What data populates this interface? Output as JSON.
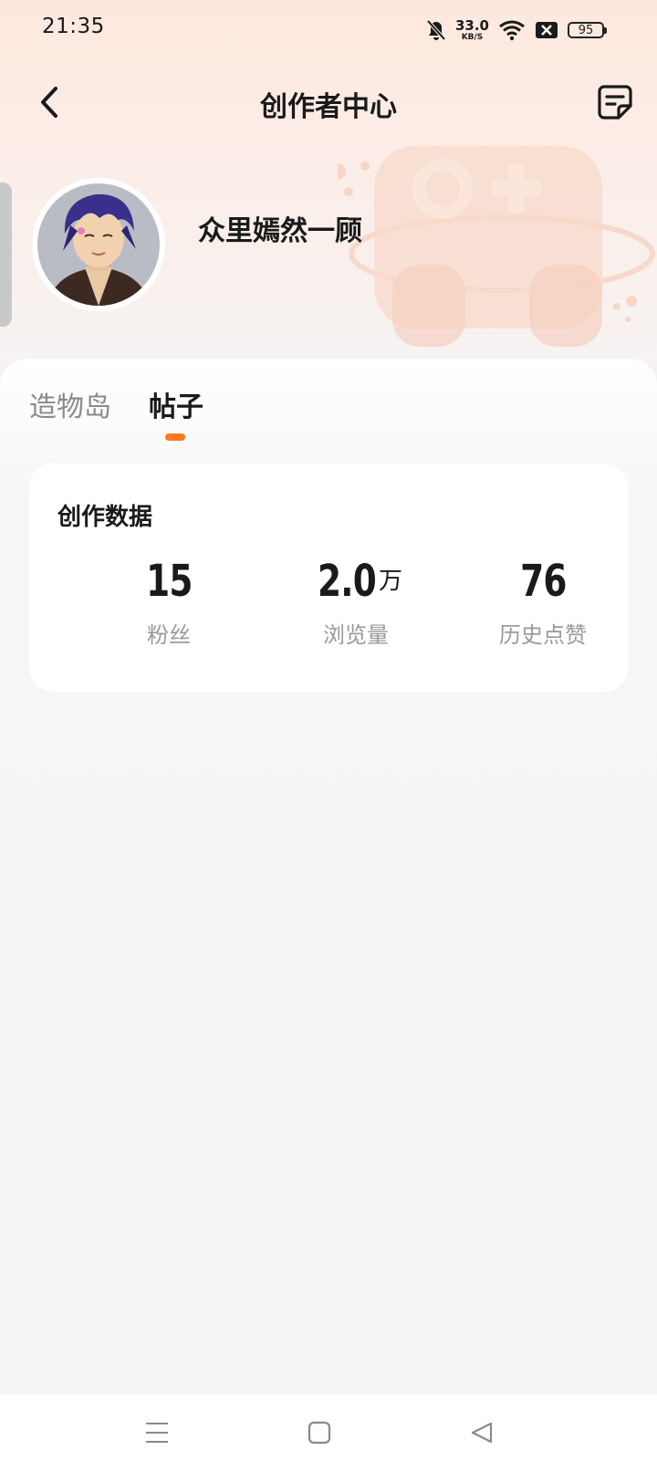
{
  "status_bar": {
    "time": "21:35",
    "net_speed": "33.0",
    "net_unit": "KB/S",
    "battery": "95"
  },
  "header": {
    "title": "创作者中心"
  },
  "profile": {
    "username": "众里嫣然一顾"
  },
  "tabs": [
    {
      "label": "造物岛",
      "active": false
    },
    {
      "label": "帖子",
      "active": true
    }
  ],
  "stats_card": {
    "title": "创作数据",
    "stats": [
      {
        "value": "15",
        "unit": "",
        "label": "粉丝"
      },
      {
        "value": "2.0",
        "unit": "万",
        "label": "浏览量"
      },
      {
        "value": "76",
        "unit": "",
        "label": "历史点赞"
      }
    ]
  },
  "colors": {
    "accent": "#ff7a1e",
    "text": "#1a1a1a",
    "muted": "#9a9a9a"
  }
}
